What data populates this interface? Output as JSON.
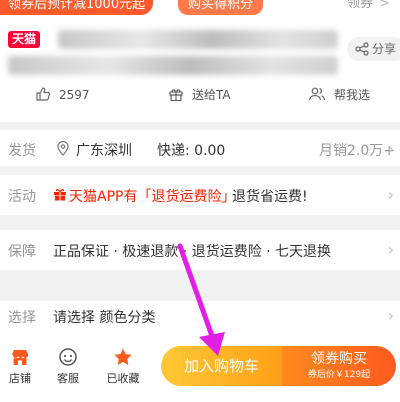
{
  "promo": {
    "coupon_text": "领券后预计减1000元起",
    "points_text": "购买得积分",
    "get_coupon": "领券",
    "get_coupon_chevron": ">"
  },
  "product": {
    "shop_badge": "天猫",
    "share_label": "分享"
  },
  "social": {
    "likes": "2597",
    "gift_label": "送给TA",
    "help_label": "帮我选"
  },
  "shipping": {
    "label": "发货",
    "location": "广东深圳",
    "fee": "快递: 0.00",
    "monthly_sales": "月销2.0万+"
  },
  "activity": {
    "label": "活动",
    "highlight": "天猫APP有「退货运费险」",
    "rest": "退货省运费!"
  },
  "guarantee": {
    "label": "保障",
    "text": "正品保证 · 极速退款 · 退货运费险 · 七天退换"
  },
  "select": {
    "label": "选择",
    "text": "请选择 颜色分类"
  },
  "bottom_bar": {
    "store": "店铺",
    "service": "客服",
    "favorited": "已收藏",
    "add_to_cart": "加入购物车",
    "buy_now": "领券购买",
    "after_coupon_price": "券后价￥129起"
  },
  "colors": {
    "accent_red": "#ff0036",
    "cart_yellow": "#ffb31f",
    "buy_orange": "#ff6a1e",
    "annotation_arrow": "#e21fe6"
  }
}
